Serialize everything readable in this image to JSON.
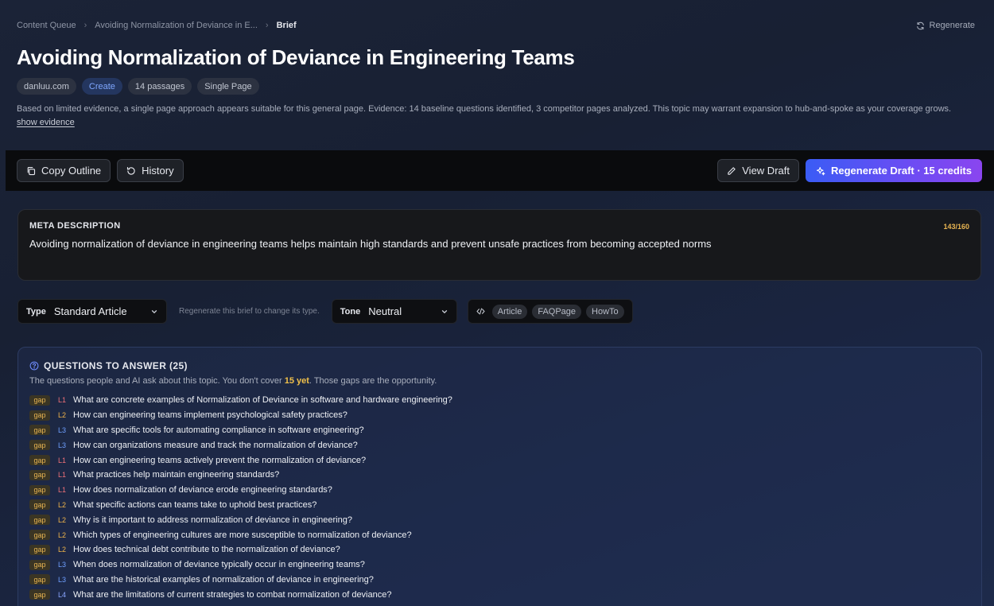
{
  "breadcrumb": {
    "items": [
      "Content Queue",
      "Avoiding Normalization of Deviance in E..."
    ],
    "current": "Brief",
    "separator": "›"
  },
  "header": {
    "regenerate_label": "Regenerate",
    "title": "Avoiding Normalization of Deviance in Engineering Teams",
    "tags": [
      "danluu.com",
      "Create",
      "14 passages",
      "Single Page"
    ],
    "evidence_text": "Based on limited evidence, a single page approach appears suitable for this general page. Evidence: 14 baseline questions identified, 3 competitor pages analyzed. This topic may warrant expansion to hub-and-spoke as your coverage grows.",
    "show_evidence": "show evidence"
  },
  "toolbar": {
    "copy_outline": "Copy Outline",
    "history": "History",
    "view_draft": "View Draft",
    "regenerate_draft": "Regenerate Draft · 15 credits"
  },
  "meta": {
    "label": "META DESCRIPTION",
    "count": "143/160",
    "description": "Avoiding normalization of deviance in engineering teams helps maintain high standards and prevent unsafe practices from becoming accepted norms"
  },
  "controls": {
    "type_label": "Type",
    "type_value": "Standard Article",
    "type_hint": "Regenerate this brief to change its type.",
    "tone_label": "Tone",
    "tone_value": "Neutral",
    "schema_chips": [
      "Article",
      "FAQPage",
      "HowTo"
    ]
  },
  "questions": {
    "title": "QUESTIONS TO ANSWER (25)",
    "sub_before": "The questions people and AI ask about this topic. You don't cover ",
    "sub_highlight": "15 yet",
    "sub_after": ". Those gaps are the opportunity.",
    "items": [
      {
        "badge": "gap",
        "level": "L1",
        "text": "What are concrete examples of Normalization of Deviance in software and hardware engineering?"
      },
      {
        "badge": "gap",
        "level": "L2",
        "text": "How can engineering teams implement psychological safety practices?"
      },
      {
        "badge": "gap",
        "level": "L3",
        "text": "What are specific tools for automating compliance in software engineering?"
      },
      {
        "badge": "gap",
        "level": "L3",
        "text": "How can organizations measure and track the normalization of deviance?"
      },
      {
        "badge": "gap",
        "level": "L1",
        "text": "How can engineering teams actively prevent the normalization of deviance?"
      },
      {
        "badge": "gap",
        "level": "L1",
        "text": "What practices help maintain engineering standards?"
      },
      {
        "badge": "gap",
        "level": "L1",
        "text": "How does normalization of deviance erode engineering standards?"
      },
      {
        "badge": "gap",
        "level": "L2",
        "text": "What specific actions can teams take to uphold best practices?"
      },
      {
        "badge": "gap",
        "level": "L2",
        "text": "Why is it important to address normalization of deviance in engineering?"
      },
      {
        "badge": "gap",
        "level": "L2",
        "text": "Which types of engineering cultures are more susceptible to normalization of deviance?"
      },
      {
        "badge": "gap",
        "level": "L2",
        "text": "How does technical debt contribute to the normalization of deviance?"
      },
      {
        "badge": "gap",
        "level": "L3",
        "text": "When does normalization of deviance typically occur in engineering teams?"
      },
      {
        "badge": "gap",
        "level": "L3",
        "text": "What are the historical examples of normalization of deviance in engineering?"
      },
      {
        "badge": "gap",
        "level": "L4",
        "text": "What are the limitations of current strategies to combat normalization of deviance?"
      }
    ]
  }
}
